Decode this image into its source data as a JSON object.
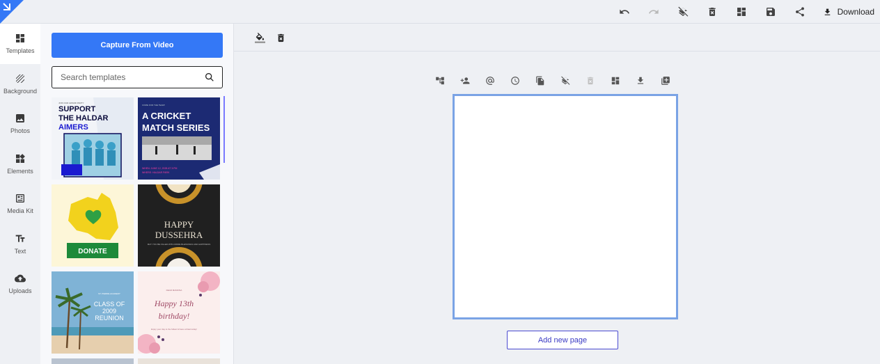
{
  "topbar": {
    "download_label": "Download",
    "actions": [
      {
        "icon": "undo-icon",
        "enabled": true
      },
      {
        "icon": "redo-icon",
        "enabled": false
      },
      {
        "icon": "layers-off-icon",
        "enabled": true
      },
      {
        "icon": "delete-icon",
        "enabled": true
      },
      {
        "icon": "dashboard-icon",
        "enabled": true
      },
      {
        "icon": "save-icon",
        "enabled": true
      },
      {
        "icon": "share-icon",
        "enabled": true
      }
    ]
  },
  "rail": {
    "items": [
      {
        "label": "Templates",
        "icon": "templates-icon",
        "active": true
      },
      {
        "label": "Background",
        "icon": "background-icon",
        "active": false
      },
      {
        "label": "Photos",
        "icon": "photos-icon",
        "active": false
      },
      {
        "label": "Elements",
        "icon": "elements-icon",
        "active": false
      },
      {
        "label": "Media Kit",
        "icon": "media-kit-icon",
        "active": false
      },
      {
        "label": "Text",
        "icon": "text-icon",
        "active": false
      },
      {
        "label": "Uploads",
        "icon": "uploads-icon",
        "active": false
      }
    ]
  },
  "panel": {
    "capture_label": "Capture From Video",
    "search_placeholder": "Search templates",
    "templates": [
      {
        "line1": "SUPPORT",
        "line2": "THE HALDAR",
        "line3": "AIMERS",
        "top": "JOIN OUR AWARD PARTY"
      },
      {
        "line1": "A CRICKET",
        "line2": "MATCH SERIES",
        "top": "COME FOR THE TEAM!",
        "info1": "WHEN: JUNE 12, 2028 AT 3:PM",
        "info2": "WHERE: HALDAR PARK"
      },
      {
        "label": "DONATE"
      },
      {
        "line1": "HAPPY",
        "line2": "DUSSEHRA",
        "sub": "MAY YOU BE FILLED WITH MORE BLESSINGS AND HAPPINESS"
      },
      {
        "top": "ST. PIERRE ACADEMY",
        "line1": "CLASS OF",
        "line2": "2009",
        "line3": "REUNION"
      },
      {
        "top": "DEAR MANDISA",
        "line1": "Happy 13th",
        "line2": "birthday!",
        "sub": "Enjoy your day to the fullest & have a blast today!"
      }
    ]
  },
  "workspace": {
    "add_page_label": "Add new page"
  },
  "colors": {
    "accent": "#3478f6",
    "page_border": "#7aa3e5",
    "add_page": "#3b3bc4"
  }
}
